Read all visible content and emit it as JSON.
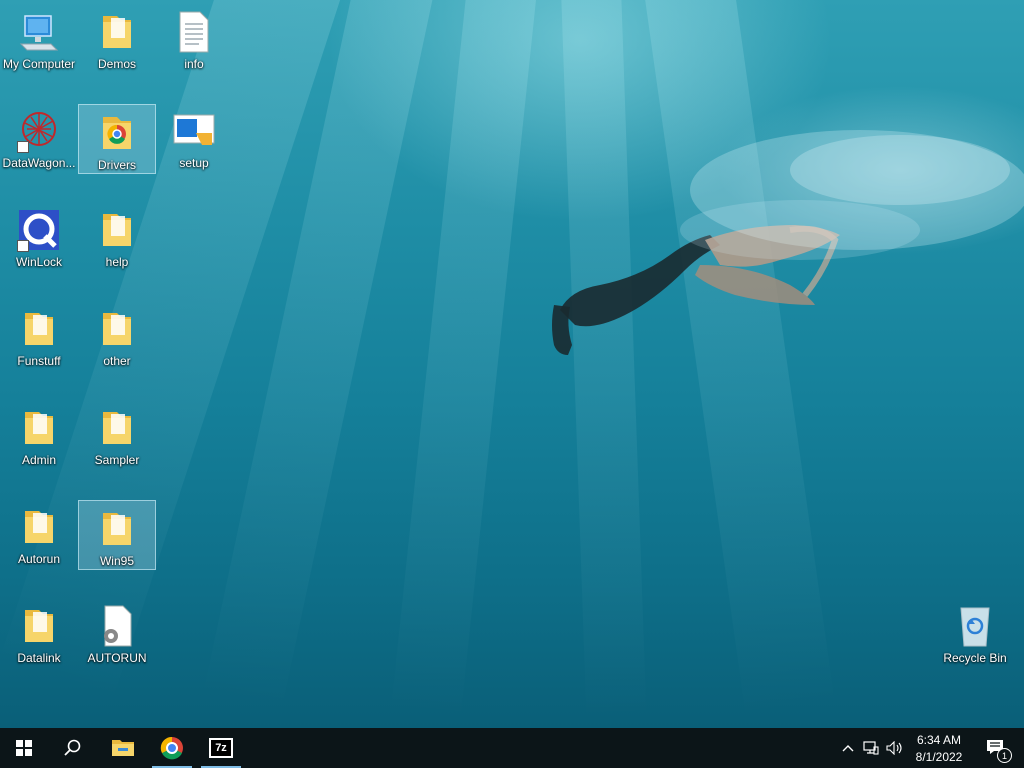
{
  "desktop": {
    "icons": [
      {
        "name": "My Computer",
        "type": "computer"
      },
      {
        "name": "Demos",
        "type": "folder"
      },
      {
        "name": "info",
        "type": "text-file"
      },
      {
        "name": "DataWagon...",
        "type": "shortcut-app"
      },
      {
        "name": "Drivers",
        "type": "folder-chrome"
      },
      {
        "name": "setup",
        "type": "setup-app"
      },
      {
        "name": "WinLock",
        "type": "shortcut-app"
      },
      {
        "name": "help",
        "type": "folder"
      },
      {
        "name": "Funstuff",
        "type": "folder"
      },
      {
        "name": "other",
        "type": "folder"
      },
      {
        "name": "Admin",
        "type": "folder"
      },
      {
        "name": "Sampler",
        "type": "folder"
      },
      {
        "name": "Autorun",
        "type": "folder"
      },
      {
        "name": "Win95",
        "type": "folder"
      },
      {
        "name": "Datalink",
        "type": "folder"
      },
      {
        "name": "AUTORUN",
        "type": "settings-file"
      },
      {
        "name": "Recycle Bin",
        "type": "recycle-bin"
      }
    ],
    "selected": [
      "Drivers",
      "Win95"
    ]
  },
  "taskbar": {
    "buttons": [
      {
        "name": "start",
        "icon": "windows-logo-icon"
      },
      {
        "name": "search",
        "icon": "search-icon"
      },
      {
        "name": "file-explorer",
        "icon": "folder-icon"
      },
      {
        "name": "chrome",
        "icon": "chrome-icon",
        "running": true
      },
      {
        "name": "7zip",
        "icon": "7zip-icon",
        "label": "7z",
        "running": true
      }
    ],
    "tray": {
      "time": "6:34 AM",
      "date": "8/1/2022",
      "notification_count": "1"
    }
  },
  "colors": {
    "taskbar_bg": "#0c1518",
    "folder_yellow": "#f3c84d",
    "water_top": "#2f9fb4",
    "water_bottom": "#0a5f78",
    "accent": "#7fbde6"
  }
}
